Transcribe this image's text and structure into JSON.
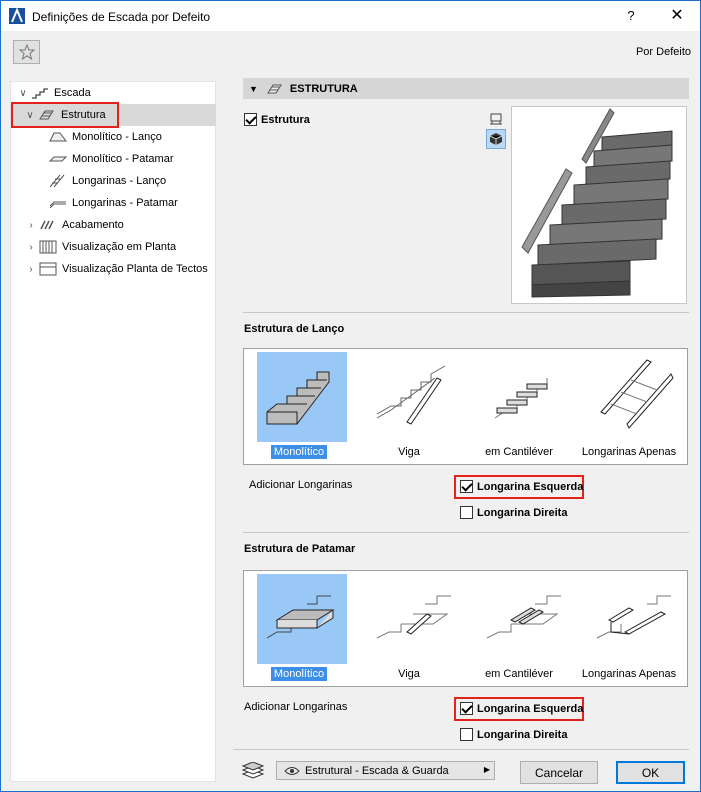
{
  "window": {
    "title": "Definições de Escada por Defeito",
    "help": "?",
    "close": "✕"
  },
  "preset": "Por Defeito",
  "tree": {
    "items": [
      {
        "label": "Escada"
      },
      {
        "label": "Estrutura"
      },
      {
        "label": "Monolítico - Lanço"
      },
      {
        "label": "Monolítico - Patamar"
      },
      {
        "label": "Longarinas - Lanço"
      },
      {
        "label": "Longarinas - Patamar"
      },
      {
        "label": "Acabamento"
      },
      {
        "label": "Visualização em Planta"
      },
      {
        "label": "Visualização Planta de Tectos"
      }
    ]
  },
  "section": {
    "title": "ESTRUTURA",
    "checkbox_label": "Estrutura"
  },
  "flight": {
    "title": "Estrutura de Lanço",
    "options": [
      "Monolítico",
      "Viga",
      "em Cantiléver",
      "Longarinas Apenas"
    ],
    "add_label": "Adicionar Longarinas",
    "left": "Longarina Esquerda",
    "right": "Longarina Direita"
  },
  "landing": {
    "title": "Estrutura de Patamar",
    "options": [
      "Monolítico",
      "Viga",
      "em Cantiléver",
      "Longarinas Apenas"
    ],
    "add_label": "Adicionar Longarinas",
    "left": "Longarina Esquerda",
    "right": "Longarina Direita"
  },
  "footer": {
    "layer_combo": "Estrutural - Escada & Guarda",
    "cancel": "Cancelar",
    "ok": "OK"
  },
  "colors": {
    "accent": "#3d8ee6",
    "highlight_red": "#e3231b",
    "selected_tile": "#99c8f7"
  }
}
